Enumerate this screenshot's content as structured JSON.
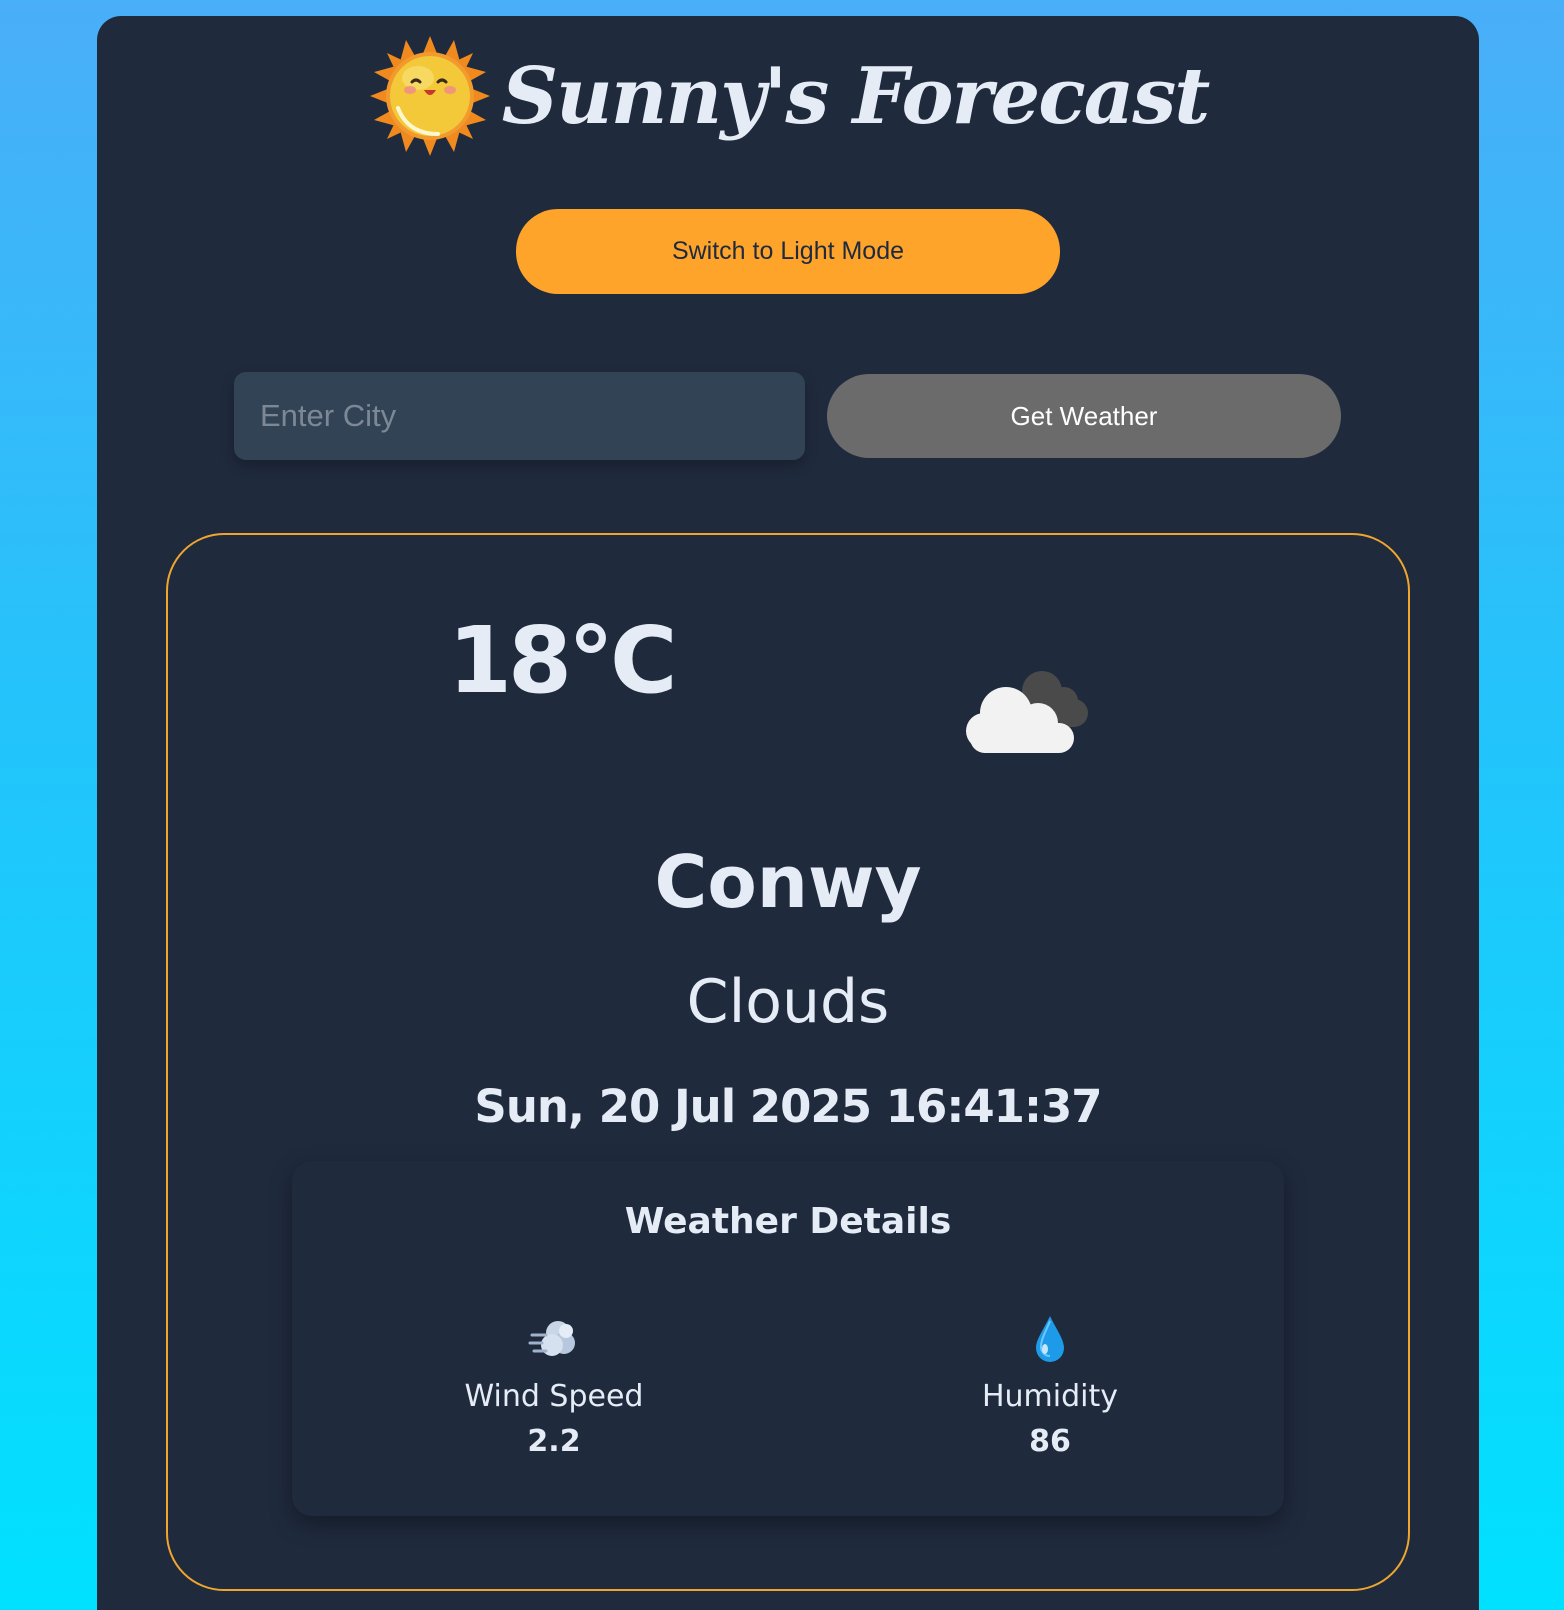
{
  "header": {
    "title": "Sunny's Forecast",
    "logo_icon": "smiling-sun-icon"
  },
  "mode_toggle": {
    "label": "Switch to Light Mode"
  },
  "search": {
    "placeholder": "Enter City",
    "value": "",
    "button_label": "Get Weather"
  },
  "weather": {
    "temperature": "18°C",
    "condition_icon": "cloud-icon",
    "city": "Conwy",
    "condition": "Clouds",
    "datetime": "Sun, 20 Jul 2025 16:41:37"
  },
  "details": {
    "title": "Weather Details",
    "wind": {
      "icon": "wind-icon",
      "label": "Wind Speed",
      "value": "2.2"
    },
    "humidity": {
      "icon": "droplet-icon",
      "label": "Humidity",
      "value": "86"
    }
  },
  "colors": {
    "background_top": "#4aaef8",
    "background_bottom": "#00e1ff",
    "panel": "#1f2a3d",
    "accent": "#ffa42b",
    "text": "#e5ecf6",
    "button_gray": "#6b6b6b",
    "input_bg": "#334356"
  }
}
